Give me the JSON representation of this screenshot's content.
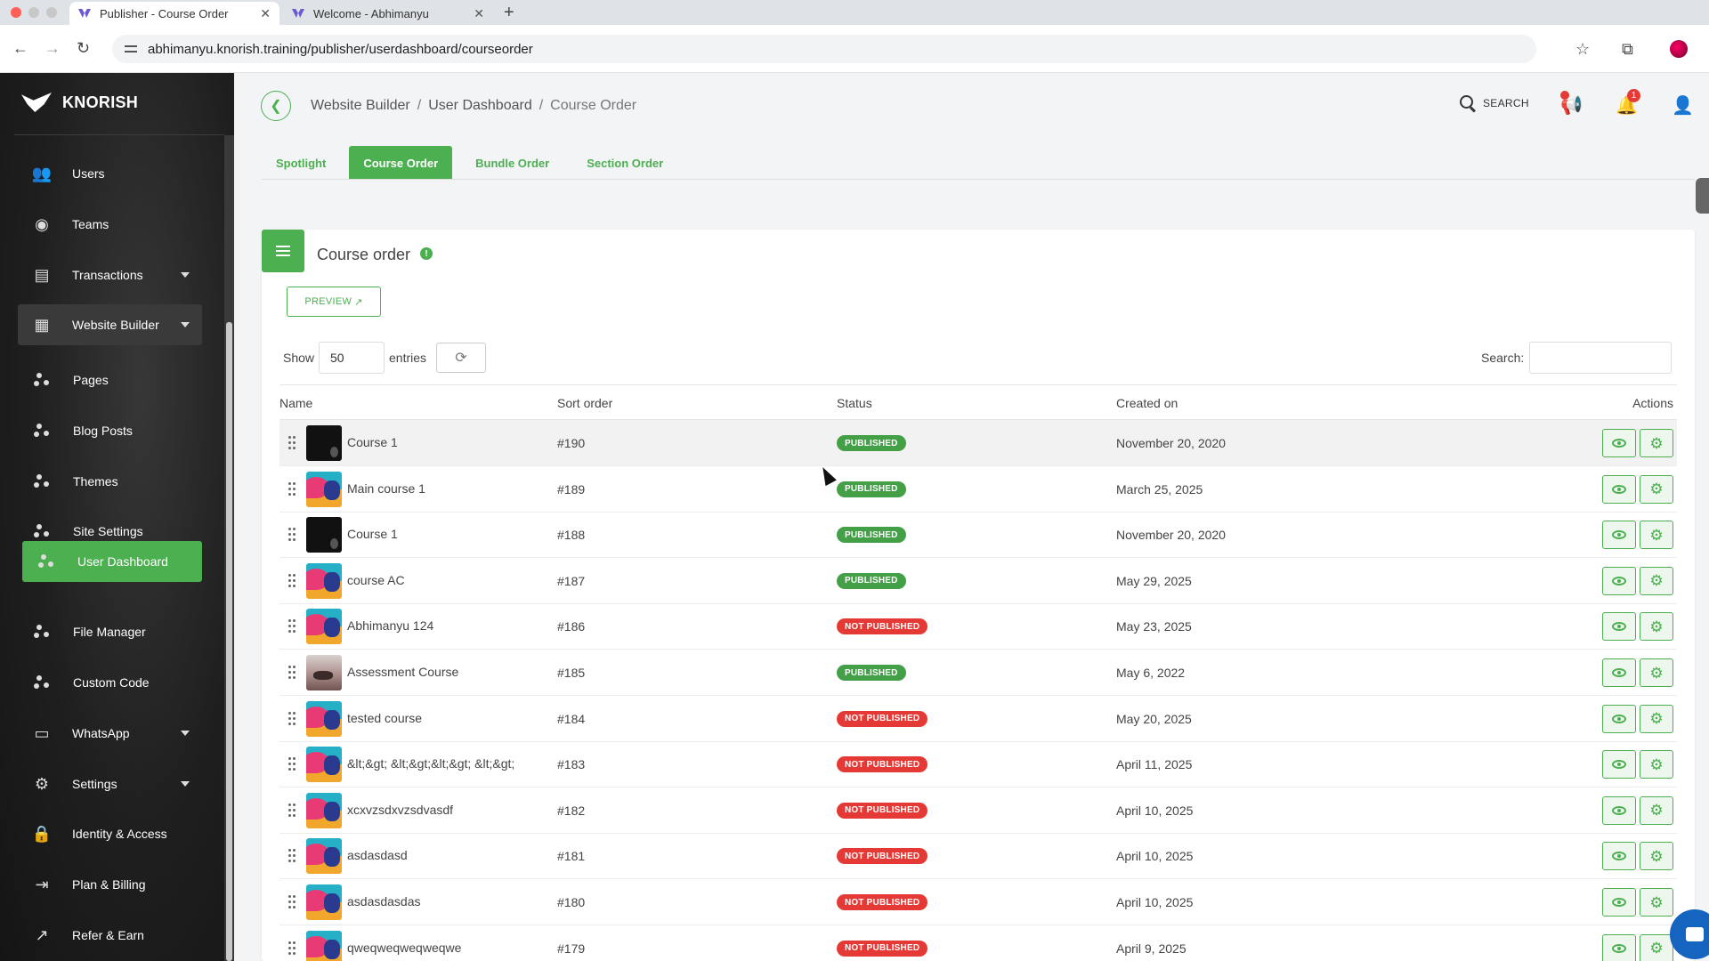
{
  "browser": {
    "tabs": [
      {
        "title": "Publisher - Course Order",
        "active": true
      },
      {
        "title": "Welcome - Abhimanyu",
        "active": false
      }
    ],
    "url": "abhimanyu.knorish.training/publisher/userdashboard/courseorder"
  },
  "brand": {
    "name": "KNORISH"
  },
  "sidebar": {
    "items": [
      {
        "label": "Users",
        "icon": "users-icon"
      },
      {
        "label": "Teams",
        "icon": "teams-icon"
      },
      {
        "label": "Transactions",
        "icon": "transactions-icon",
        "has_caret": true
      },
      {
        "label": "Website Builder",
        "icon": "website-builder-icon",
        "has_caret": true,
        "expanded": true
      },
      {
        "label": "Pages",
        "icon": "dots-icon",
        "sub": true
      },
      {
        "label": "Blog Posts",
        "icon": "dots-icon",
        "sub": true
      },
      {
        "label": "Themes",
        "icon": "dots-icon",
        "sub": true
      },
      {
        "label": "Site Settings",
        "icon": "dots-icon",
        "sub": true
      },
      {
        "label": "User Dashboard",
        "icon": "dots-icon",
        "sub": true,
        "active": true
      },
      {
        "label": "File Manager",
        "icon": "dots-icon",
        "sub": true
      },
      {
        "label": "Custom Code",
        "icon": "dots-icon",
        "sub": true
      },
      {
        "label": "WhatsApp",
        "icon": "whatsapp-icon",
        "has_caret": true
      },
      {
        "label": "Settings",
        "icon": "gear-icon",
        "has_caret": true
      },
      {
        "label": "Identity & Access",
        "icon": "lock-icon"
      },
      {
        "label": "Plan & Billing",
        "icon": "billing-icon"
      },
      {
        "label": "Refer & Earn",
        "icon": "trend-icon"
      }
    ]
  },
  "header": {
    "breadcrumb": [
      "Website Builder",
      "User Dashboard",
      "Course Order"
    ],
    "search_label": "SEARCH",
    "notification_count": "1"
  },
  "subtabs": [
    {
      "label": "Spotlight",
      "active": false
    },
    {
      "label": "Course Order",
      "active": true
    },
    {
      "label": "Bundle Order",
      "active": false
    },
    {
      "label": "Section Order",
      "active": false
    }
  ],
  "card": {
    "title": "Course order",
    "preview_label": "PREVIEW",
    "show_label": "Show",
    "show_value": "50",
    "entries_label": "entries",
    "search_label": "Search:",
    "search_value": ""
  },
  "table": {
    "columns": [
      "Name",
      "Sort order",
      "Status",
      "Created on",
      "Actions"
    ],
    "rows": [
      {
        "name": "Course 1",
        "sort": "#190",
        "status": "PUBLISHED",
        "created": "November 20, 2020",
        "thumb": "dark"
      },
      {
        "name": "Main course 1",
        "sort": "#189",
        "status": "PUBLISHED",
        "created": "March 25, 2025",
        "thumb": "art"
      },
      {
        "name": "Course 1",
        "sort": "#188",
        "status": "PUBLISHED",
        "created": "November 20, 2020",
        "thumb": "dark"
      },
      {
        "name": "course AC",
        "sort": "#187",
        "status": "PUBLISHED",
        "created": "May 29, 2025",
        "thumb": "art"
      },
      {
        "name": "Abhimanyu 124",
        "sort": "#186",
        "status": "NOT PUBLISHED",
        "created": "May 23, 2025",
        "thumb": "art"
      },
      {
        "name": "Assessment Course",
        "sort": "#185",
        "status": "PUBLISHED",
        "created": "May 6, 2022",
        "thumb": "photo"
      },
      {
        "name": "tested course",
        "sort": "#184",
        "status": "NOT PUBLISHED",
        "created": "May 20, 2025",
        "thumb": "art"
      },
      {
        "name": "&lt;&gt; &lt;&gt;&lt;&gt; &lt;&gt;",
        "sort": "#183",
        "status": "NOT PUBLISHED",
        "created": "April 11, 2025",
        "thumb": "art"
      },
      {
        "name": "xcxvzsdxvzsdvasdf",
        "sort": "#182",
        "status": "NOT PUBLISHED",
        "created": "April 10, 2025",
        "thumb": "art"
      },
      {
        "name": "asdasdasd",
        "sort": "#181",
        "status": "NOT PUBLISHED",
        "created": "April 10, 2025",
        "thumb": "art"
      },
      {
        "name": "asdasdasdas",
        "sort": "#180",
        "status": "NOT PUBLISHED",
        "created": "April 10, 2025",
        "thumb": "art"
      },
      {
        "name": "qweqweqweqweqwe",
        "sort": "#179",
        "status": "NOT PUBLISHED",
        "created": "April 9, 2025",
        "thumb": "art"
      }
    ]
  },
  "colors": {
    "accent": "#4caf50",
    "published": "#43a047",
    "not_published": "#e53935",
    "sidebar_bg": "#1d1d1d"
  }
}
